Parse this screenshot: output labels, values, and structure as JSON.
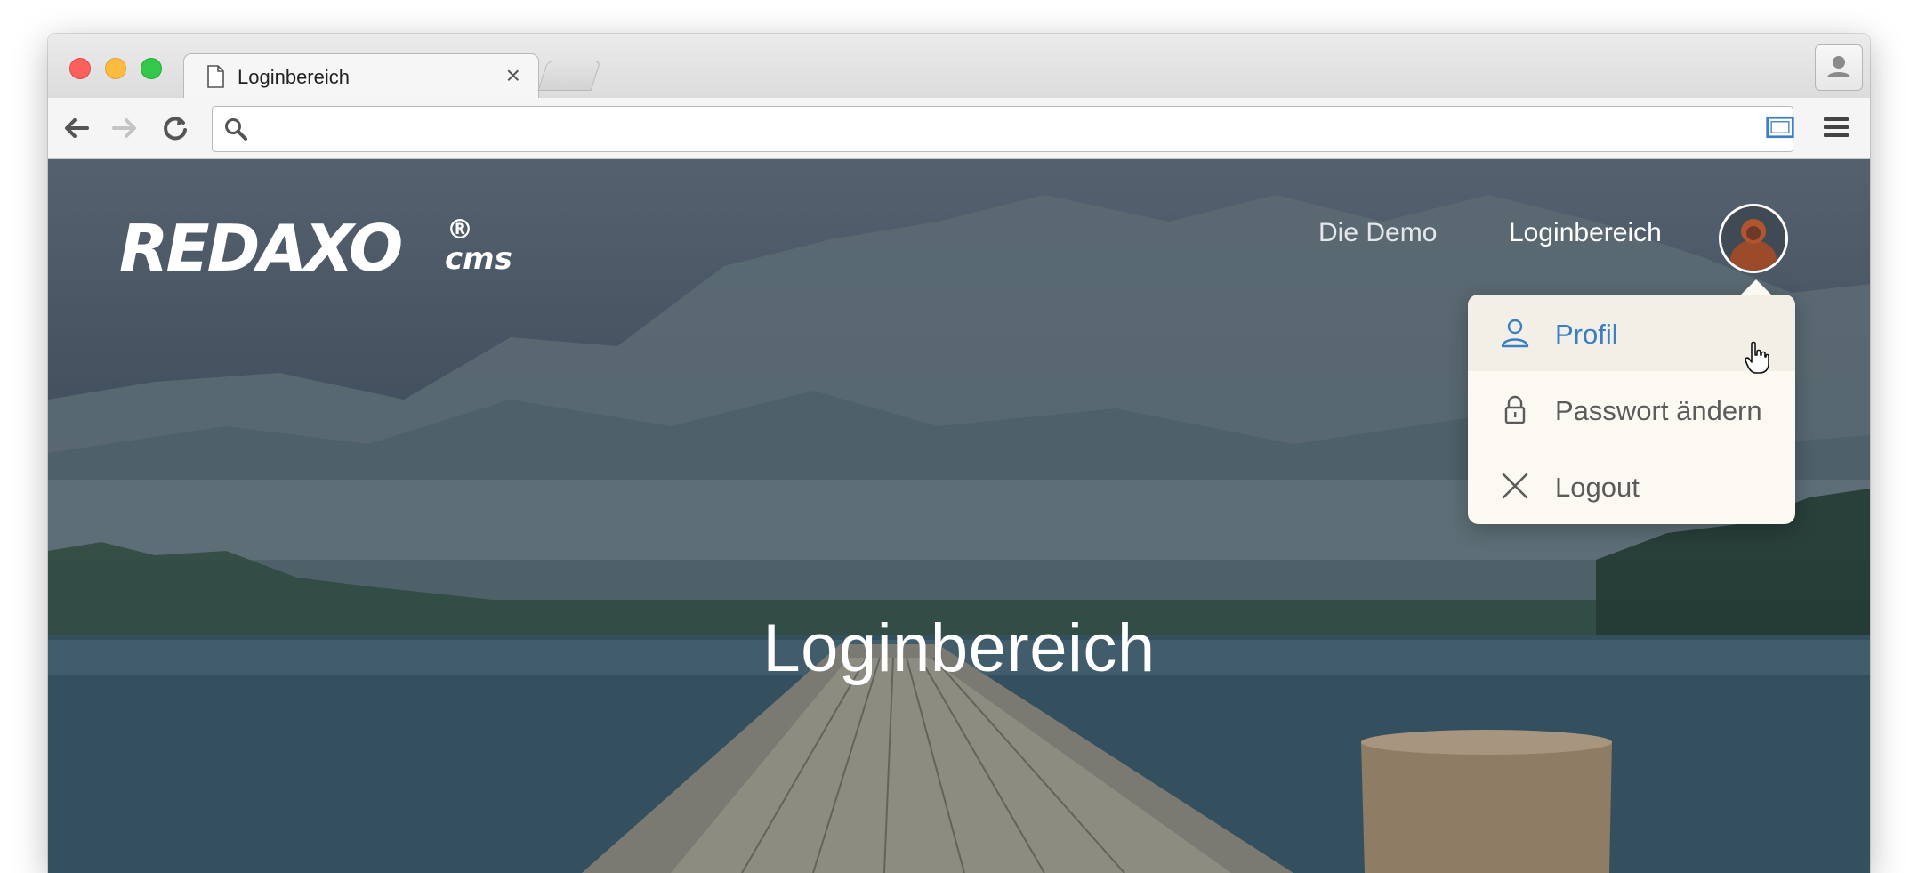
{
  "browser": {
    "tab_title": "Loginbereich",
    "tab_close": "×",
    "address_value": "",
    "colors": {
      "close": "#fc605c",
      "minimize": "#fdbc40",
      "zoom": "#34c84a"
    }
  },
  "site": {
    "logo_text": "REDAXO",
    "logo_reg": "®",
    "logo_sub": "cms",
    "nav": {
      "demo": "Die Demo",
      "login": "Loginbereich"
    },
    "user_menu": {
      "items": [
        {
          "label": "Profil",
          "icon": "user-icon",
          "active": true
        },
        {
          "label": "Passwort ändern",
          "icon": "lock-icon",
          "active": false
        },
        {
          "label": "Logout",
          "icon": "close-icon",
          "active": false
        }
      ],
      "active_color": "#3a7ec6"
    },
    "hero_title": "Loginbereich"
  }
}
